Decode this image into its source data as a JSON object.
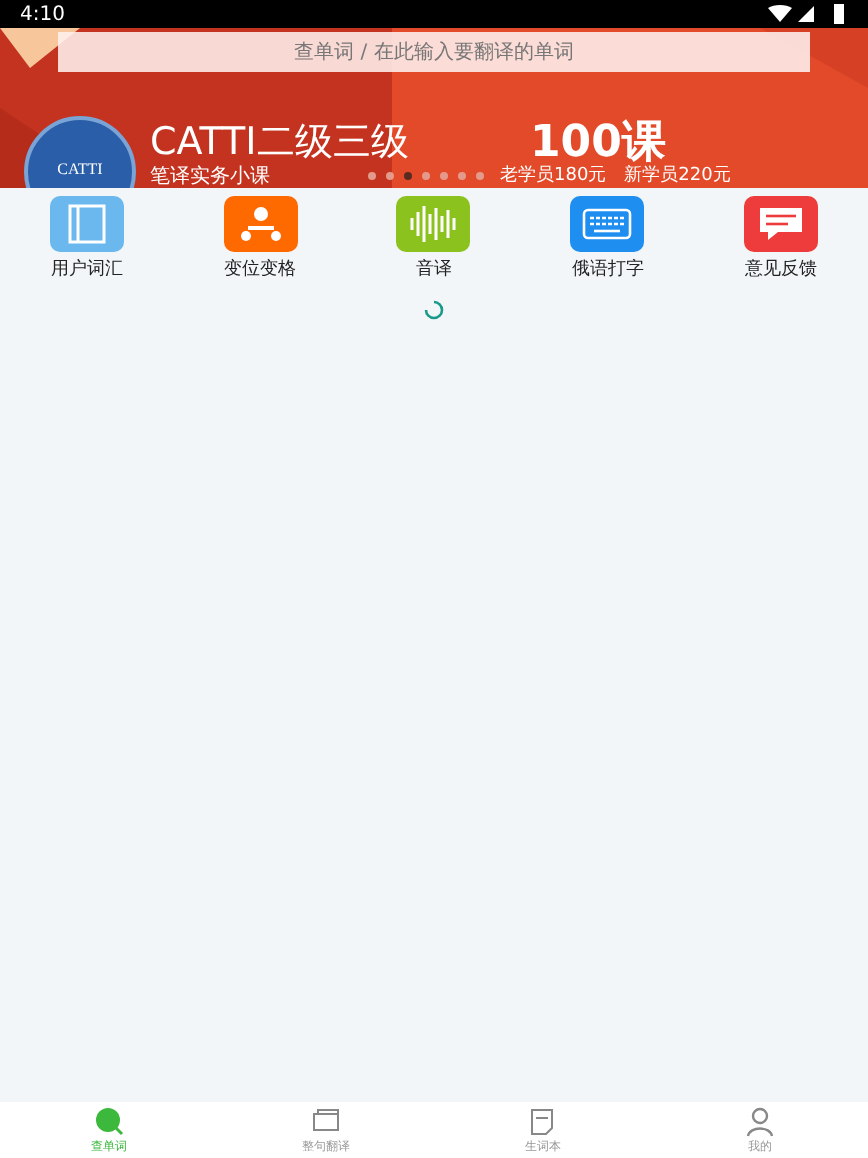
{
  "status_bar": {
    "time": "4:10"
  },
  "search": {
    "placeholder": "查单词 / 在此输入要翻译的单词"
  },
  "banner": {
    "title": "CATTI二级三级",
    "highlight": "100课",
    "subtitle": "笔译实务小课",
    "price": "老学员180元　新学员220元",
    "badge": "CATTI",
    "dots": [
      {
        "selected": false
      },
      {
        "selected": false
      },
      {
        "selected": true
      },
      {
        "selected": false
      },
      {
        "selected": false
      },
      {
        "selected": false
      },
      {
        "selected": false
      }
    ]
  },
  "shortcuts": [
    {
      "label": "用户词汇",
      "kind": "book",
      "color": "#6ab8ee"
    },
    {
      "label": "变位变格",
      "kind": "nodes",
      "color": "#ff6a00"
    },
    {
      "label": "音译",
      "kind": "wave",
      "color": "#8cc21e"
    },
    {
      "label": "俄语打字",
      "kind": "keyboard",
      "color": "#1e8ef0"
    },
    {
      "label": "意见反馈",
      "kind": "chat",
      "color": "#ee3b3b"
    }
  ],
  "loading": true,
  "tabs": [
    {
      "label": "查单词",
      "kind": "search",
      "selected": true
    },
    {
      "label": "整句翻译",
      "kind": "translate",
      "selected": false
    },
    {
      "label": "生词本",
      "kind": "notebook",
      "selected": false
    },
    {
      "label": "我的",
      "kind": "person",
      "selected": false
    }
  ]
}
